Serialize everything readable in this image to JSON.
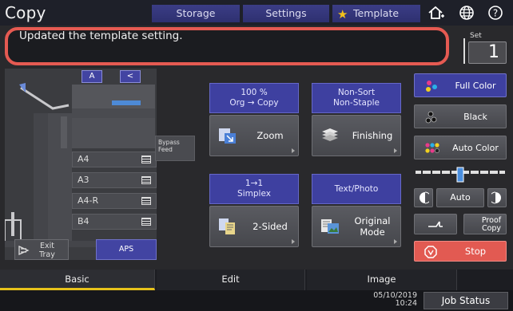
{
  "header": {
    "title": "Copy",
    "tabs": [
      "Storage",
      "Settings",
      "Template"
    ]
  },
  "message": {
    "text": "Updated the template setting.",
    "set_label": "Set",
    "set_value": "1"
  },
  "machine": {
    "orientation_a": "A",
    "orientation_b": "<",
    "bypass_label": "Bypass Feed",
    "trays": [
      "A4",
      "A3",
      "A4-R",
      "B4"
    ],
    "exit_tray_label": "Exit Tray",
    "aps_label": "APS"
  },
  "functions": {
    "zoom_head": [
      "100 %",
      "Org  →  Copy"
    ],
    "zoom_label": "Zoom",
    "finishing_head": [
      "Non-Sort",
      "Non-Staple"
    ],
    "finishing_label": "Finishing",
    "duplex_head": [
      "1→1",
      "Simplex"
    ],
    "duplex_label": "2-Sided",
    "mode_head": [
      "Text/Photo"
    ],
    "mode_label": "Original Mode"
  },
  "right_panel": {
    "full_color": "Full Color",
    "black": "Black",
    "auto_color": "Auto Color",
    "density_auto": "Auto",
    "proof_copy": "Proof Copy",
    "stop": "Stop"
  },
  "bottom_tabs": [
    "Basic",
    "Edit",
    "Image"
  ],
  "status": {
    "date": "05/10/2019",
    "time": "10:24",
    "job_status": "Job Status"
  },
  "colors": {
    "accent_blue": "#3e40a0",
    "stop_red": "#e25a52",
    "highlight_red": "#e55a52",
    "active_tab_yellow": "#e6c21a"
  }
}
